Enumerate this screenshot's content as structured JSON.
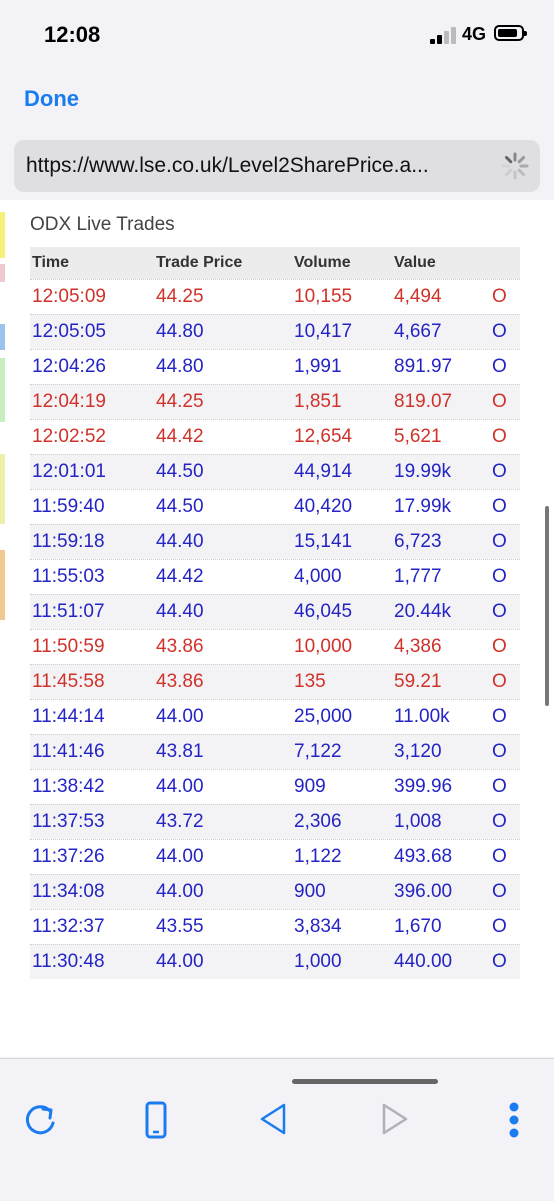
{
  "status_bar": {
    "time": "12:08",
    "network": "4G"
  },
  "nav": {
    "done_label": "Done"
  },
  "url_bar": {
    "url": "https://www.lse.co.uk/Level2SharePrice.a..."
  },
  "trades": {
    "title": "ODX Live Trades",
    "headers": [
      "Time",
      "Trade Price",
      "Volume",
      "Value"
    ],
    "rows": [
      {
        "time": "12:05:09",
        "price": "44.25",
        "volume": "10,155",
        "value": "4,494",
        "flag": "O",
        "color": "red"
      },
      {
        "time": "12:05:05",
        "price": "44.80",
        "volume": "10,417",
        "value": "4,667",
        "flag": "O",
        "color": "blue"
      },
      {
        "time": "12:04:26",
        "price": "44.80",
        "volume": "1,991",
        "value": "891.97",
        "flag": "O",
        "color": "blue"
      },
      {
        "time": "12:04:19",
        "price": "44.25",
        "volume": "1,851",
        "value": "819.07",
        "flag": "O",
        "color": "red"
      },
      {
        "time": "12:02:52",
        "price": "44.42",
        "volume": "12,654",
        "value": "5,621",
        "flag": "O",
        "color": "red"
      },
      {
        "time": "12:01:01",
        "price": "44.50",
        "volume": "44,914",
        "value": "19.99k",
        "flag": "O",
        "color": "blue"
      },
      {
        "time": "11:59:40",
        "price": "44.50",
        "volume": "40,420",
        "value": "17.99k",
        "flag": "O",
        "color": "blue"
      },
      {
        "time": "11:59:18",
        "price": "44.40",
        "volume": "15,141",
        "value": "6,723",
        "flag": "O",
        "color": "blue"
      },
      {
        "time": "11:55:03",
        "price": "44.42",
        "volume": "4,000",
        "value": "1,777",
        "flag": "O",
        "color": "blue"
      },
      {
        "time": "11:51:07",
        "price": "44.40",
        "volume": "46,045",
        "value": "20.44k",
        "flag": "O",
        "color": "blue"
      },
      {
        "time": "11:50:59",
        "price": "43.86",
        "volume": "10,000",
        "value": "4,386",
        "flag": "O",
        "color": "red"
      },
      {
        "time": "11:45:58",
        "price": "43.86",
        "volume": "135",
        "value": "59.21",
        "flag": "O",
        "color": "red"
      },
      {
        "time": "11:44:14",
        "price": "44.00",
        "volume": "25,000",
        "value": "11.00k",
        "flag": "O",
        "color": "blue"
      },
      {
        "time": "11:41:46",
        "price": "43.81",
        "volume": "7,122",
        "value": "3,120",
        "flag": "O",
        "color": "blue"
      },
      {
        "time": "11:38:42",
        "price": "44.00",
        "volume": "909",
        "value": "399.96",
        "flag": "O",
        "color": "blue"
      },
      {
        "time": "11:37:53",
        "price": "43.72",
        "volume": "2,306",
        "value": "1,008",
        "flag": "O",
        "color": "blue"
      },
      {
        "time": "11:37:26",
        "price": "44.00",
        "volume": "1,122",
        "value": "493.68",
        "flag": "O",
        "color": "blue"
      },
      {
        "time": "11:34:08",
        "price": "44.00",
        "volume": "900",
        "value": "396.00",
        "flag": "O",
        "color": "blue"
      },
      {
        "time": "11:32:37",
        "price": "43.55",
        "volume": "3,834",
        "value": "1,670",
        "flag": "O",
        "color": "blue"
      },
      {
        "time": "11:30:48",
        "price": "44.00",
        "volume": "1,000",
        "value": "440.00",
        "flag": "O",
        "color": "blue"
      }
    ]
  },
  "colors": {
    "accent": "#1a7cf0",
    "buy": "#2424c4",
    "sell": "#d0322a"
  },
  "toolbar": {
    "icons": [
      "reload-icon",
      "phone-icon",
      "back-icon",
      "forward-icon",
      "more-icon"
    ]
  }
}
